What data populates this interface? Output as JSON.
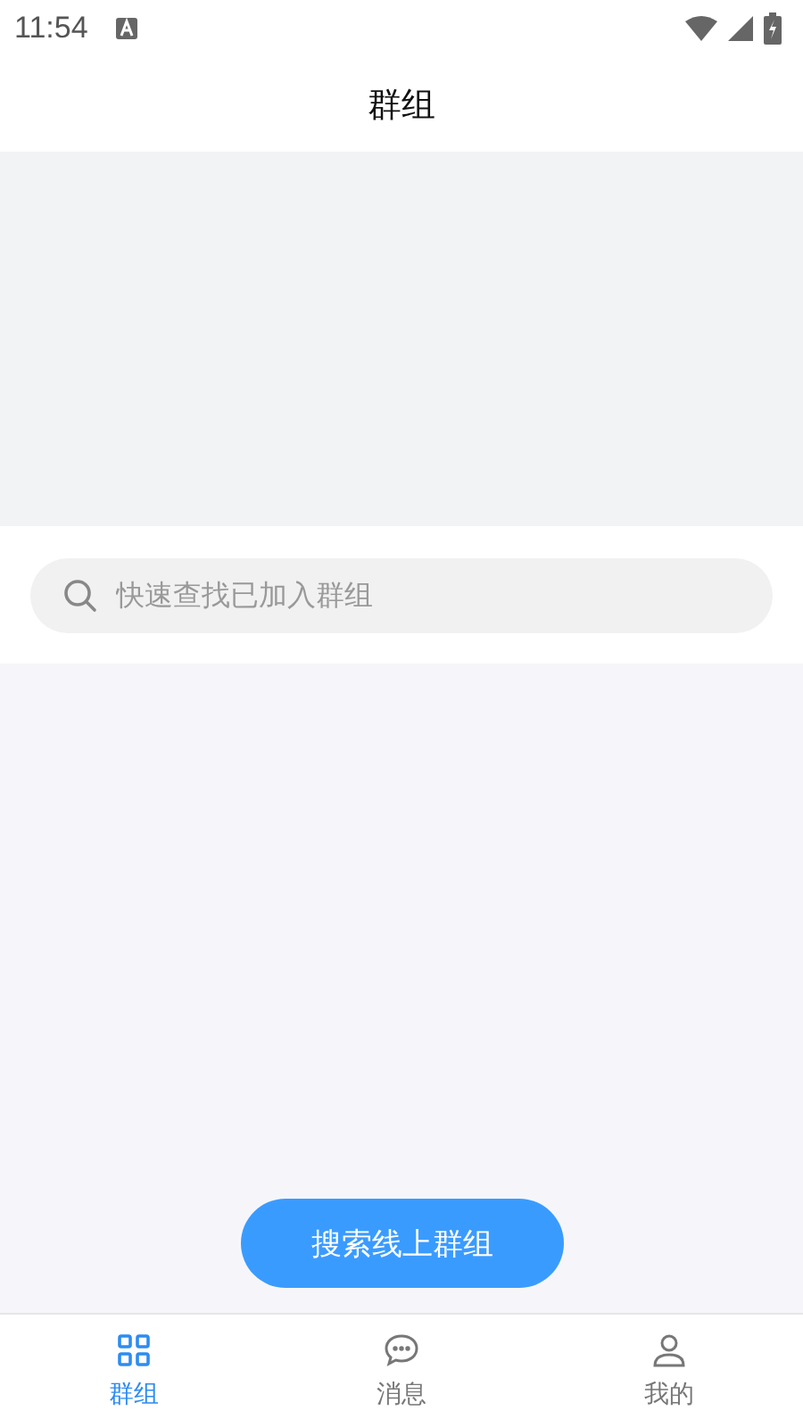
{
  "status_bar": {
    "time": "11:54"
  },
  "header": {
    "title": "群组"
  },
  "search": {
    "placeholder": "快速查找已加入群组"
  },
  "action_button": {
    "label": "搜索线上群组"
  },
  "tabs": [
    {
      "label": "群组",
      "kind": "grid",
      "selected": true
    },
    {
      "label": "消息",
      "kind": "chat",
      "selected": false
    },
    {
      "label": "我的",
      "kind": "person",
      "selected": false
    }
  ]
}
